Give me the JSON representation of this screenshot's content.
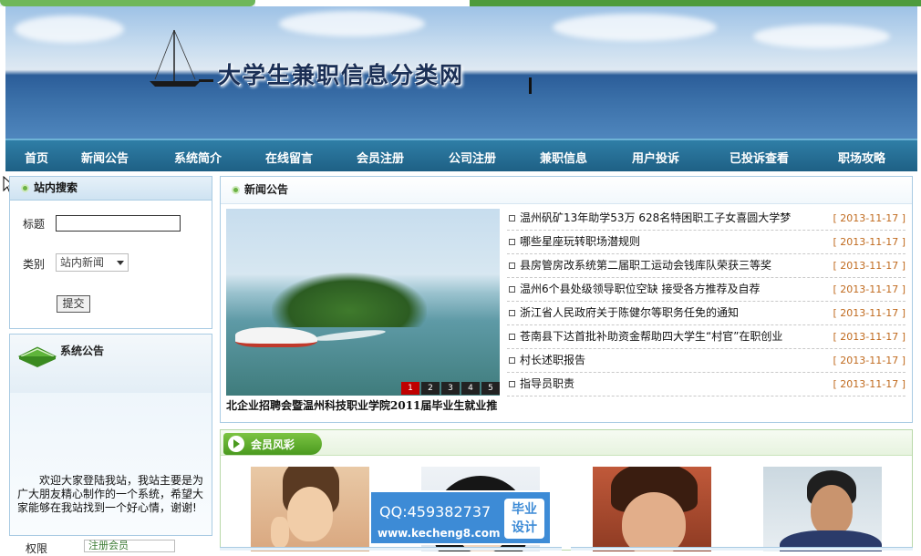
{
  "site": {
    "title": "大学生兼职信息分类网"
  },
  "nav": {
    "items": [
      "首页",
      "新闻公告",
      "系统简介",
      "在线留言",
      "会员注册",
      "公司注册",
      "兼职信息",
      "用户投诉",
      "已投诉查看",
      "职场攻略"
    ]
  },
  "search": {
    "heading": "站内搜索",
    "title_label": "标题",
    "title_value": "",
    "category_label": "类别",
    "category_value": "站内新闻",
    "submit_label": "提交"
  },
  "notice": {
    "heading": "系统公告",
    "text": "欢迎大家登陆我站，我站主要是为广大朋友精心制作的一个系统，希望大家能够在我站找到一个好心情，谢谢!"
  },
  "permission": {
    "label": "权限",
    "value": "注册会员"
  },
  "news": {
    "heading": "新闻公告",
    "caption": "北企业招聘会暨温州科技职业学院2011届毕业生就业推",
    "pager": [
      "1",
      "2",
      "3",
      "4",
      "5"
    ],
    "items": [
      {
        "title": "温州矾矿13年助学53万 628名特困职工子女喜圆大学梦",
        "date": "[ 2013-11-17 ]"
      },
      {
        "title": "哪些星座玩转职场潜规则",
        "date": "[ 2013-11-17 ]"
      },
      {
        "title": "县房管房改系统第二届职工运动会钱库队荣获三等奖",
        "date": "[ 2013-11-17 ]"
      },
      {
        "title": "温州6个县处级领导职位空缺 接受各方推荐及自荐",
        "date": "[ 2013-11-17 ]"
      },
      {
        "title": "浙江省人民政府关于陈健尔等职务任免的通知",
        "date": "[ 2013-11-17 ]"
      },
      {
        "title": "苍南县下达首批补助资金帮助四大学生“村官”在职创业",
        "date": "[ 2013-11-17 ]"
      },
      {
        "title": "村长述职报告",
        "date": "[ 2013-11-17 ]"
      },
      {
        "title": "指导员职责",
        "date": "[ 2013-11-17 ]"
      }
    ]
  },
  "members": {
    "heading": "会员风彩"
  },
  "watermark": {
    "qq": "QQ:459382737",
    "url": "www.kecheng8.com",
    "badge_line1": "毕业",
    "badge_line2": "设计"
  },
  "colors": {
    "nav": "#1e6085",
    "date": "#c06a1e",
    "member_tab": "#4a9a1f",
    "watermark": "#3d8bd6"
  }
}
